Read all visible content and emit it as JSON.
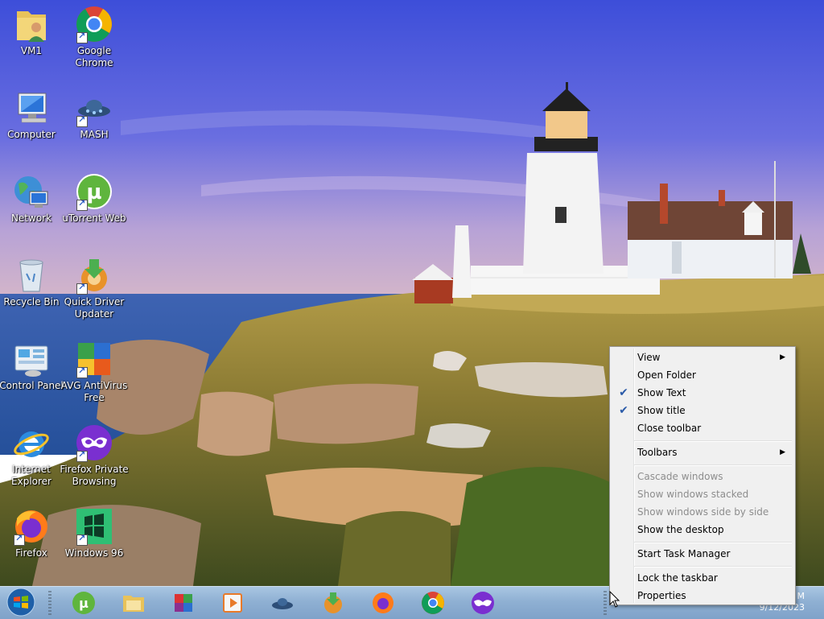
{
  "desktop": {
    "icons": [
      {
        "label": "VM1",
        "icon": "folder-user-icon"
      },
      {
        "label": "Google Chrome",
        "icon": "chrome-icon"
      },
      {
        "label": "Computer",
        "icon": "computer-icon"
      },
      {
        "label": "MASH",
        "icon": "mash-ufo-icon"
      },
      {
        "label": "Network",
        "icon": "network-icon"
      },
      {
        "label": "uTorrent Web",
        "icon": "utorrent-icon"
      },
      {
        "label": "Recycle Bin",
        "icon": "recycle-bin-icon"
      },
      {
        "label": "Quick Driver Updater",
        "icon": "driver-updater-icon"
      },
      {
        "label": "Control Panel",
        "icon": "control-panel-icon"
      },
      {
        "label": "AVG AntiVirus Free",
        "icon": "avg-icon"
      },
      {
        "label": "Internet Explorer",
        "icon": "ie-icon"
      },
      {
        "label": "Firefox Private Browsing",
        "icon": "firefox-private-icon"
      },
      {
        "label": "Firefox",
        "icon": "firefox-icon"
      },
      {
        "label": "Windows 96",
        "icon": "windows96-icon"
      }
    ]
  },
  "taskbar": {
    "pinned": [
      "utorrent-icon",
      "file-explorer-icon",
      "winrar-icon",
      "media-player-icon",
      "mash-ufo-icon",
      "driver-updater-icon",
      "firefox-icon",
      "chrome-icon",
      "firefox-private-icon"
    ],
    "clock_time": "M",
    "clock_date": "9/12/2023"
  },
  "context_menu": {
    "items": {
      "view": "View",
      "open_folder": "Open Folder",
      "show_text": "Show Text",
      "show_title": "Show title",
      "close_toolbar": "Close toolbar",
      "toolbars": "Toolbars",
      "cascade": "Cascade windows",
      "stacked": "Show windows stacked",
      "side_by_side": "Show windows side by side",
      "show_desktop": "Show the desktop",
      "task_manager": "Start Task Manager",
      "lock_taskbar": "Lock the taskbar",
      "properties": "Properties"
    },
    "checked": [
      "show_text",
      "show_title"
    ],
    "disabled": [
      "cascade",
      "stacked",
      "side_by_side"
    ]
  },
  "colors": {
    "sky_top": "#3f4fd6",
    "sea": "#2b5fa8",
    "taskbar": "#8fb0d3",
    "menu_bg": "#f0f0f0"
  }
}
